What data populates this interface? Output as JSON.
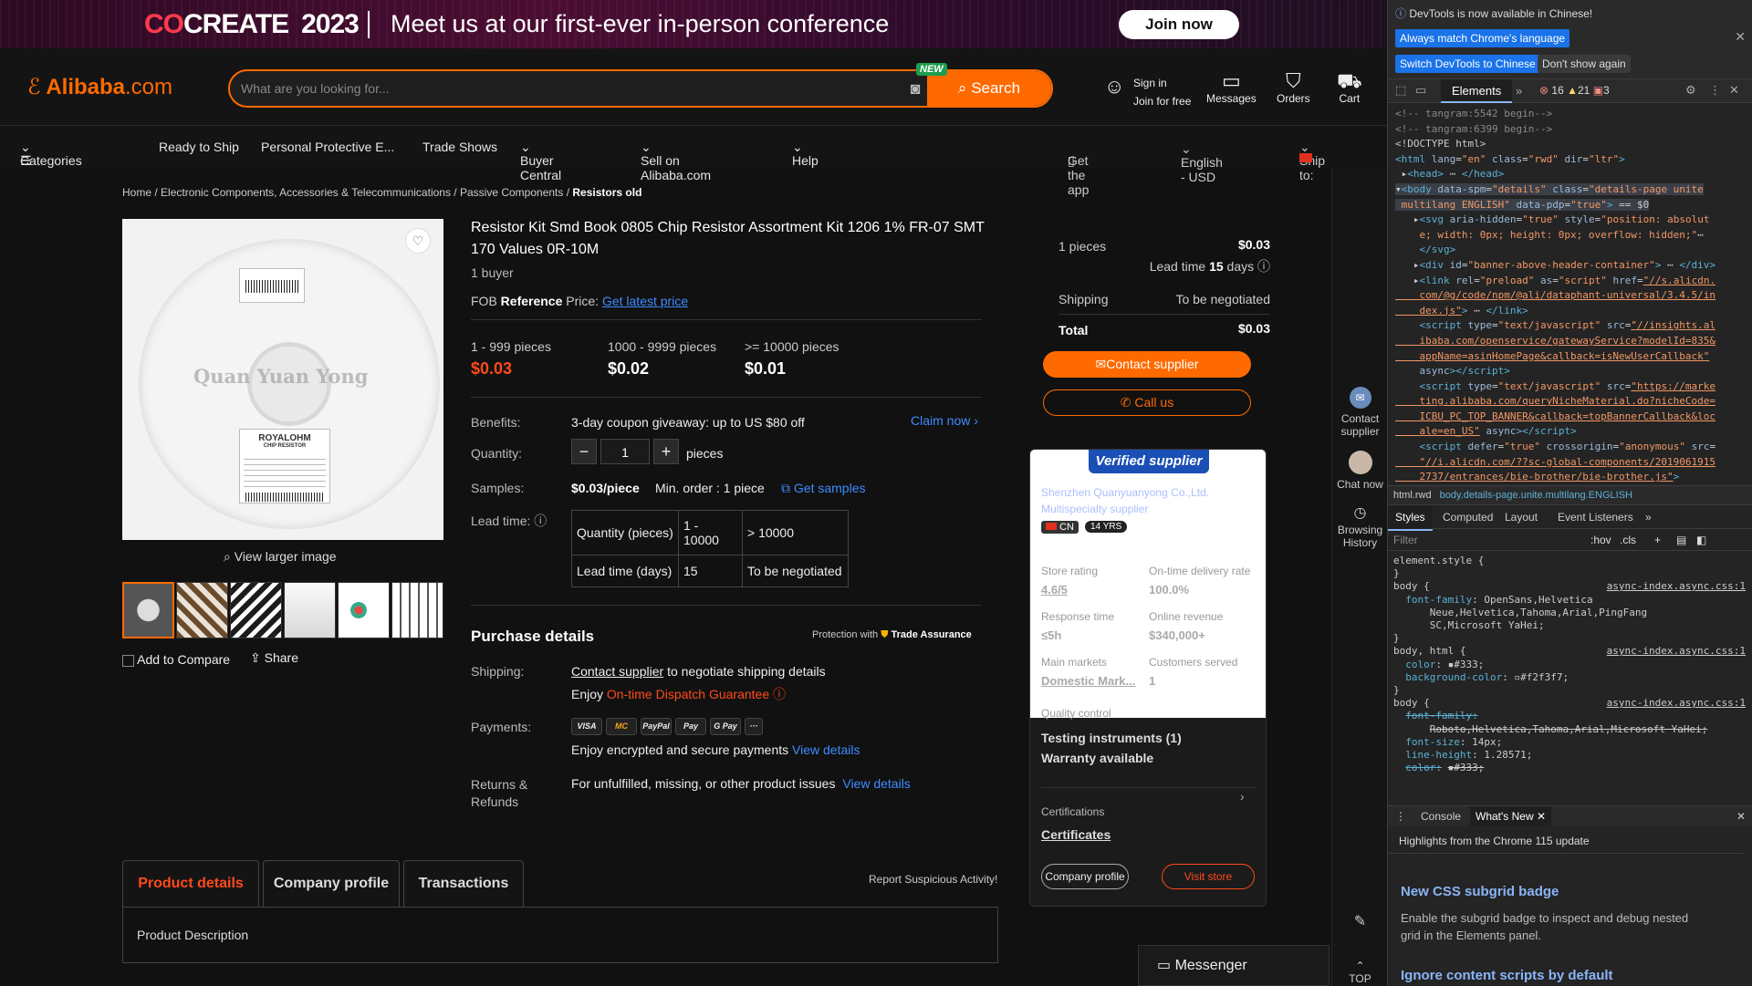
{
  "banner": {
    "brand_a": "CO",
    "brand_b": "CREATE",
    "year": "2023",
    "tagline": "Meet us at our first-ever in-person conference",
    "join": "Join now"
  },
  "header": {
    "logo_main": "Alibaba",
    "logo_tld": ".com",
    "search_placeholder": "What are you looking for...",
    "search_button": "Search",
    "new_badge": "NEW",
    "signin": "Sign in",
    "join_free": "Join for free",
    "messages": "Messages",
    "orders": "Orders",
    "cart": "Cart"
  },
  "nav": {
    "categories": "Categories",
    "items": [
      "Ready to Ship",
      "Personal Protective E...",
      "Trade Shows",
      "Buyer Central",
      "Sell on Alibaba.com",
      "Help"
    ],
    "get_app": "Get the app",
    "language": "English - USD",
    "ship_to": "Ship to:"
  },
  "breadcrumb": [
    "Home",
    "Electronic Components, Accessories & Telecommunications",
    "Passive Components",
    "Resistors old"
  ],
  "gallery": {
    "watermark": "Quan Yuan Yong",
    "label_brand": "ROYALOHM",
    "label_sub": "CHIP RESISTOR",
    "view_larger": "View larger image",
    "compare": "Add to Compare",
    "share": "Share"
  },
  "product": {
    "title": "Resistor Kit Smd Book 0805 Chip Resistor Assortment Kit 1206 1% FR-07 SMT 170 Values 0R-10M",
    "buyers": "1 buyer",
    "fob_prefix": "FOB",
    "fob_ref": "Reference",
    "fob_price": "Price:",
    "fob_link": "Get latest price",
    "tiers": [
      {
        "range": "1 - 999 pieces",
        "price": "$0.03"
      },
      {
        "range": "1000 - 9999 pieces",
        "price": "$0.02"
      },
      {
        "range": ">= 10000 pieces",
        "price": "$0.01"
      }
    ],
    "benefits_label": "Benefits:",
    "benefits_text": "3-day coupon giveaway: up to US $80 off",
    "claim": "Claim now",
    "quantity_label": "Quantity:",
    "quantity_value": "1",
    "quantity_unit": "pieces",
    "samples_label": "Samples:",
    "samples_price": "$0.03/piece",
    "samples_min": "Min. order : 1 piece",
    "samples_link": "Get samples",
    "lead_label": "Lead time:",
    "lead_table": {
      "row1": [
        "Quantity (pieces)",
        "1 - 10000",
        "> 10000"
      ],
      "row2": [
        "Lead time (days)",
        "15",
        "To be negotiated"
      ]
    }
  },
  "purchase": {
    "heading": "Purchase details",
    "protection": "Protection with",
    "trade_assurance": "Trade Assurance",
    "shipping_label": "Shipping:",
    "shipping_link": "Contact supplier",
    "shipping_text": "to negotiate shipping details",
    "enjoy": "Enjoy",
    "dispatch": "On-time Dispatch Guarantee",
    "payments_label": "Payments:",
    "pay_icons": [
      "VISA",
      "MC",
      "PayPal",
      "Pay",
      "G Pay",
      "···"
    ],
    "payments_text": "Enjoy encrypted and secure payments",
    "view_details": "View details",
    "returns_label_1": "Returns &",
    "returns_label_2": "Refunds",
    "returns_text": "For unfulfilled, missing, or other product issues",
    "returns_link": "View details"
  },
  "price_card": {
    "qty": "1 pieces",
    "qty_price": "$0.03",
    "lead_prefix": "Lead time",
    "lead_days": "15",
    "lead_suffix": "days",
    "shipping": "Shipping",
    "shipping_value": "To be negotiated",
    "total": "Total",
    "total_value": "$0.03",
    "contact": "Contact supplier",
    "call": "Call us"
  },
  "supplier": {
    "badge": "Verified supplier",
    "name": "Shenzhen Quanyuanyong Co.,Ltd.",
    "type": "Multispecialty supplier",
    "country": "CN",
    "years": "14 YRS",
    "store_rating_label": "Store rating",
    "store_rating": "4.6/5",
    "delivery_label": "On-time delivery rate",
    "delivery": "100.0%",
    "response_label": "Response time",
    "response": "≤5h",
    "revenue_label": "Online revenue",
    "revenue": "$340,000+",
    "markets_label": "Main markets",
    "markets": "Domestic Mark...",
    "customers_label": "Customers served",
    "customers": "1",
    "quality": "Quality control",
    "testing": "Testing instruments (1)",
    "warranty": "Warranty available",
    "certs_label": "Certifications",
    "certs_link": "Certificates",
    "company_profile": "Company profile",
    "visit_store": "Visit store"
  },
  "rail": {
    "contact": "Contact supplier",
    "chat": "Chat now",
    "history": "Browsing History",
    "top": "TOP"
  },
  "bottom": {
    "tabs": [
      "Product details",
      "Company profile",
      "Transactions"
    ],
    "report": "Report Suspicious Activity!",
    "desc": "Product Description",
    "messenger": "Messenger"
  },
  "devtools": {
    "info": "DevTools is now available in Chinese!",
    "btn_match": "Always match Chrome's language",
    "btn_switch": "Switch DevTools to Chinese",
    "btn_dont": "Don't show again",
    "tab_elements": "Elements",
    "errors": "16",
    "warnings": "21",
    "issues": "3",
    "crumb_html": "html.rwd",
    "crumb_body": "body.details-page.unite.multilang.ENGLISH",
    "style_tabs": [
      "Styles",
      "Computed",
      "Layout",
      "Event Listeners"
    ],
    "filter": "Filter",
    "hov": ":hov",
    "cls": ".cls",
    "drawer_console": "Console",
    "drawer_whatsnew": "What's New",
    "highlights": "Highlights from the Chrome 115 update",
    "news1_title": "New CSS subgrid badge",
    "news1_text": "Enable the subgrid badge to inspect and debug nested grid in the Elements panel.",
    "news2_title": "Ignore content scripts by default"
  },
  "colors": {
    "accent": "#ff6a00",
    "price_red": "#ff4a1a",
    "link": "#3d8bff",
    "verified": "#1a4fb5"
  }
}
